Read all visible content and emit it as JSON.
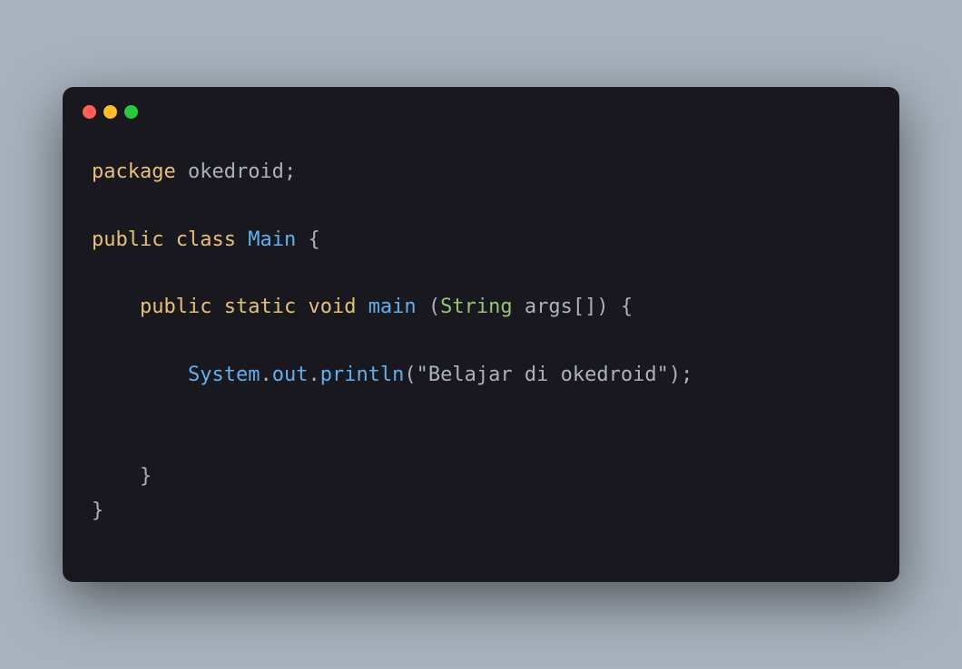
{
  "colors": {
    "bg": "#a8b2bd",
    "window": "#18181e",
    "red": "#ff5f56",
    "yellow": "#ffbd2e",
    "green": "#27c93f",
    "keyword": "#e5c07b",
    "identifier": "#61afef",
    "type": "#98c379",
    "default": "#abb2bf"
  },
  "code": {
    "line1": {
      "package_kw": "package",
      "package_name": "okedroid",
      "semi": ";"
    },
    "line2": {
      "public_kw": "public",
      "class_kw": "class",
      "class_name": "Main",
      "brace_open": "{"
    },
    "line3": {
      "indent": "    ",
      "public_kw": "public",
      "static_kw": "static",
      "void_kw": "void",
      "method_name": "main",
      "paren_open": "(",
      "param_type": "String",
      "param_name": "args",
      "brackets": "[]",
      "paren_close": ")",
      "brace_open": "{"
    },
    "line4": {
      "indent": "        ",
      "system": "System",
      "dot1": ".",
      "out": "out",
      "dot2": ".",
      "println": "println",
      "paren_open": "(",
      "string": "\"Belajar di okedroid\"",
      "paren_close": ")",
      "semi": ";"
    },
    "line5": {
      "indent": "    ",
      "brace_close": "}"
    },
    "line6": {
      "brace_close": "}"
    }
  }
}
